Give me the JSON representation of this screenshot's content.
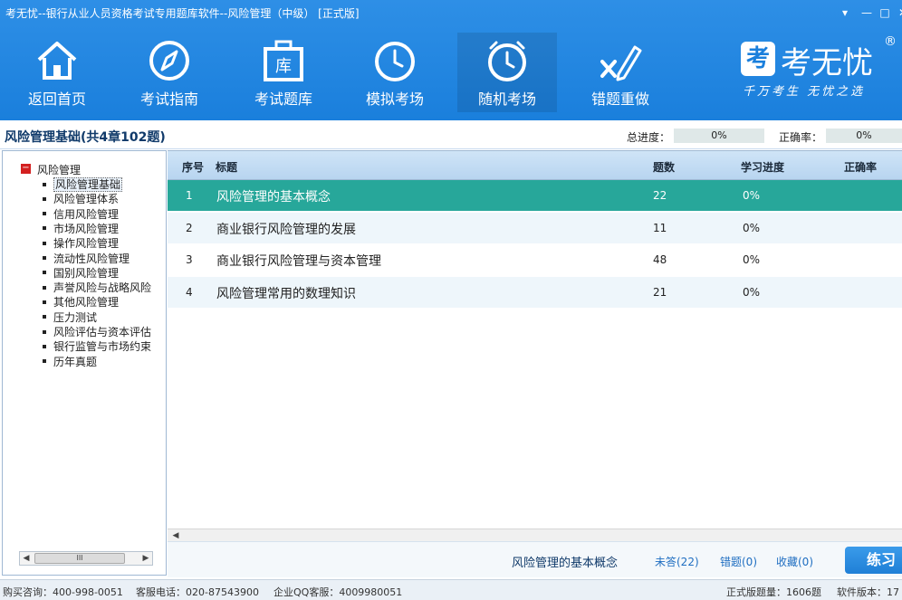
{
  "window": {
    "title": "考无忧--银行从业人员资格考试专用题库软件--风险管理（中级） [正式版]",
    "controls": [
      "▾",
      "—",
      "□",
      "✕"
    ]
  },
  "nav": [
    {
      "label": "返回首页",
      "icon": "home-icon"
    },
    {
      "label": "考试指南",
      "icon": "compass-icon"
    },
    {
      "label": "考试题库",
      "icon": "question-bank-icon",
      "icon_text": "库"
    },
    {
      "label": "模拟考场",
      "icon": "clock-icon"
    },
    {
      "label": "随机考场",
      "icon": "alarm-clock-icon",
      "active": true
    },
    {
      "label": "错题重做",
      "icon": "redo-wrong-icon"
    }
  ],
  "brand": {
    "logo_char": "考",
    "name": "考无忧",
    "reg": "®",
    "slogan": "千万考生  无忧之选"
  },
  "info": {
    "course_title": "风险管理基础(共4章102题)",
    "total_progress_label": "总进度：",
    "total_progress_value": "0%",
    "accuracy_label": "正确率：",
    "accuracy_value": "0%"
  },
  "tree": {
    "root": "风险管理",
    "items": [
      "风险管理基础",
      "风险管理体系",
      "信用风险管理",
      "市场风险管理",
      "操作风险管理",
      "流动性风险管理",
      "国别风险管理",
      "声誉风险与战略风险",
      "其他风险管理",
      "压力测试",
      "风险评估与资本评估",
      "银行监管与市场约束",
      "历年真题"
    ],
    "selected_index": 0,
    "scroll_thumb": "III"
  },
  "table": {
    "headers": {
      "no": "序号",
      "title": "标题",
      "count": "题数",
      "progress": "学习进度",
      "accuracy": "正确率"
    },
    "rows": [
      {
        "no": "1",
        "title": "风险管理的基本概念",
        "count": "22",
        "progress": "0%",
        "accuracy": ""
      },
      {
        "no": "2",
        "title": "商业银行风险管理的发展",
        "count": "11",
        "progress": "0%",
        "accuracy": ""
      },
      {
        "no": "3",
        "title": "商业银行风险管理与资本管理",
        "count": "48",
        "progress": "0%",
        "accuracy": ""
      },
      {
        "no": "4",
        "title": "风险管理常用的数理知识",
        "count": "21",
        "progress": "0%",
        "accuracy": ""
      }
    ],
    "selected_row": 0
  },
  "actions": {
    "current_title": "风险管理的基本概念",
    "unanswered": "未答(22)",
    "wrong": "错题(0)",
    "favorites": "收藏(0)",
    "practice": "练习"
  },
  "status": {
    "purchase": "购买咨询：400-998-0051",
    "service_phone": "客服电话：020-87543900",
    "qq_service": "企业QQ客服：4009980051",
    "question_count": "正式版题量：1606题",
    "version": "软件版本：17"
  },
  "colors": {
    "header_blue": "#1a7fdc",
    "selected_row": "#27a79a",
    "link_blue": "#1f6ec1"
  }
}
